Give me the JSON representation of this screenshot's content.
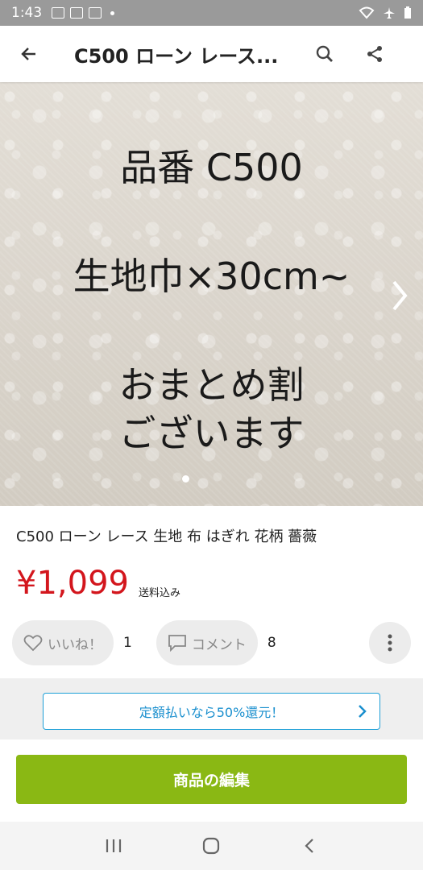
{
  "status_bar": {
    "time": "1:43"
  },
  "app_bar": {
    "title": "C500 ローン レース..."
  },
  "hero": {
    "line1": "品番 C500",
    "line2": "生地巾×30cm~",
    "line3": "おまとめ割",
    "line4": "ございます"
  },
  "product": {
    "name": "C500 ローン レース 生地 布 はぎれ 花柄 薔薇",
    "price": "¥1,099",
    "shipping": "送料込み"
  },
  "actions": {
    "like_label": "いいね！",
    "like_count": "1",
    "comment_label": "コメント",
    "comment_count": "8"
  },
  "promo": {
    "text": "定額払いなら50%還元！"
  },
  "edit_button": {
    "label": "商品の編集"
  },
  "colors": {
    "price": "#d3161d",
    "edit_button": "#8ab814",
    "promo_border": "#1da0d8"
  }
}
